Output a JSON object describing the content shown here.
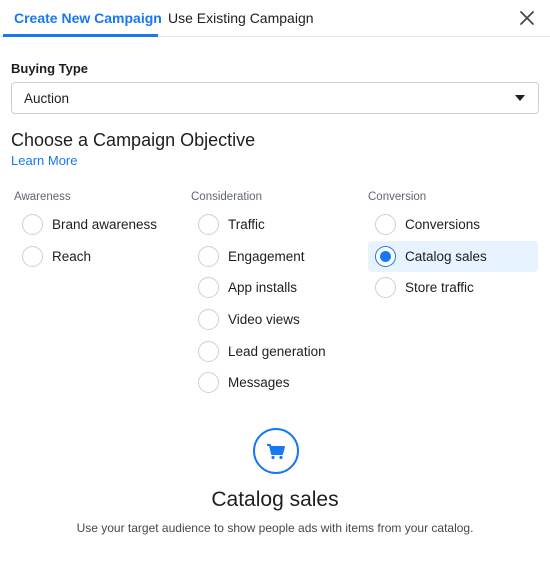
{
  "tabs": [
    {
      "label": "Create New Campaign",
      "active": true
    },
    {
      "label": "Use Existing Campaign",
      "active": false
    }
  ],
  "buying_type": {
    "label": "Buying Type",
    "value": "Auction"
  },
  "objective": {
    "heading": "Choose a Campaign Objective",
    "learn_more": "Learn More"
  },
  "columns": [
    {
      "title": "Awareness",
      "options": [
        "Brand awareness",
        "Reach"
      ]
    },
    {
      "title": "Consideration",
      "options": [
        "Traffic",
        "Engagement",
        "App installs",
        "Video views",
        "Lead generation",
        "Messages"
      ]
    },
    {
      "title": "Conversion",
      "options": [
        "Conversions",
        "Catalog sales",
        "Store traffic"
      ]
    }
  ],
  "selected_option": "Catalog sales",
  "detail": {
    "title": "Catalog sales",
    "description": "Use your target audience to show people ads with items from your catalog.",
    "icon": "shopping-cart-icon"
  },
  "colors": {
    "accent": "#1877f2",
    "selected_bg": "#e7f3ff"
  }
}
